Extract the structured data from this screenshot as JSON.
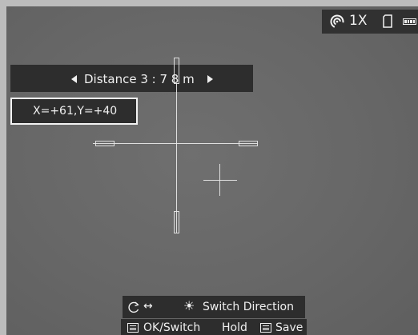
{
  "status": {
    "zoom": "1X",
    "icons": [
      "hotspot-icon",
      "sd-card-icon",
      "battery-icon"
    ]
  },
  "distance": {
    "text": "Distance 3 : 7 8 m"
  },
  "coordinates": {
    "text": "X=+61,Y=+40"
  },
  "help": {
    "switch_direction": "Switch Direction",
    "ok_switch": "OK/Switch",
    "hold": "Hold",
    "save": "Save"
  },
  "colors": {
    "panel": "#2d2d2d",
    "text": "#f0f0f0",
    "thermal_bg": "#676767"
  }
}
